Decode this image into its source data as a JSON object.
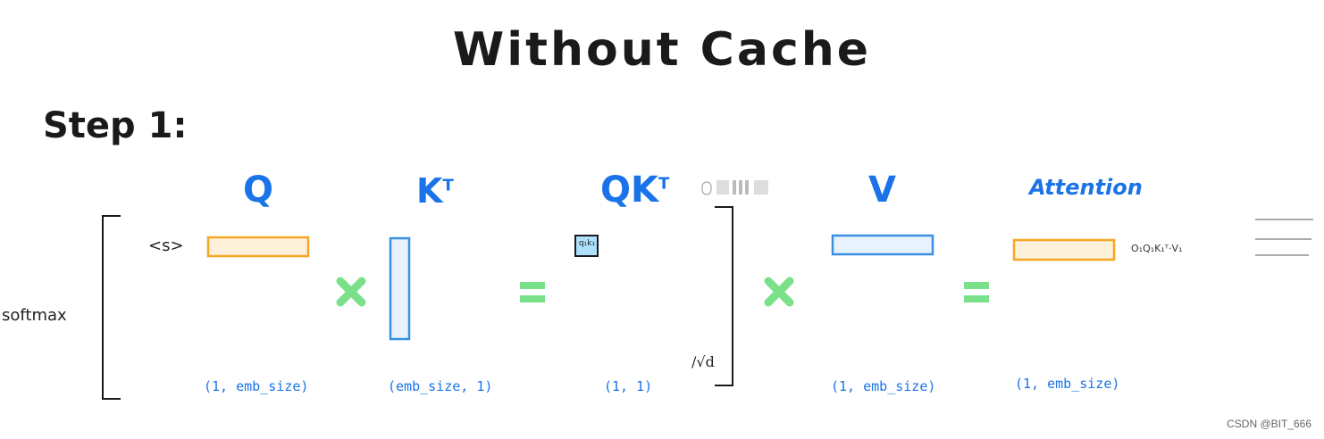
{
  "title": "Without Cache",
  "step_label": "Step 1:",
  "softmax_label": "softmax",
  "token_label": "<s>",
  "labels": {
    "q": "Q",
    "k": "K",
    "k_sup": "T",
    "qk": "QK",
    "qk_sup": "T",
    "v": "V",
    "attention": "Attention"
  },
  "dims": {
    "q": "(1, emb_size)",
    "k": "(emb_size, 1)",
    "qk": "(1, 1)",
    "v": "(1, emb_size)",
    "attention": "(1, emb_size)"
  },
  "qk_cell": "q₁k₁",
  "sqrt_label": "/√d",
  "attention_formula": "O₁Q₁K₁ᵀ·V₁",
  "watermark": "CSDN @BIT_666",
  "colors": {
    "orange": "#f5a623",
    "orange_fill": "#fdf1dc",
    "blue": "#3b8fe3",
    "blue_fill": "#e8f2fd",
    "green": "#7be08a",
    "cell_fill": "#aee0fb"
  }
}
